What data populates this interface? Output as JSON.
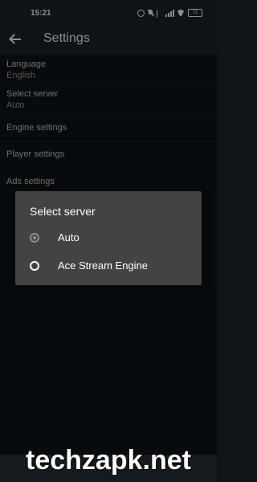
{
  "status_bar": {
    "time": "15:21",
    "battery": "72",
    "icons": [
      "alarm-icon",
      "mute-icon",
      "bluetooth-icon",
      "signal-icon",
      "wifi-icon",
      "battery-icon"
    ]
  },
  "app_bar": {
    "title": "Settings",
    "back_icon": "arrow-left-icon"
  },
  "settings": [
    {
      "title": "Language",
      "subtitle": "English"
    },
    {
      "title": "Select server",
      "subtitle": "Auto"
    },
    {
      "title": "Engine settings"
    },
    {
      "title": "Player settings"
    },
    {
      "title": "Ads settings"
    }
  ],
  "dialog": {
    "title": "Select server",
    "options": [
      {
        "label": "Auto",
        "selected": true
      },
      {
        "label": "Ace Stream Engine",
        "selected": false
      }
    ]
  },
  "watermark": "techzapk.net",
  "colors": {
    "dialog_bg": "#434343",
    "app_bar": "#1e2327",
    "background": "#0f1418"
  }
}
